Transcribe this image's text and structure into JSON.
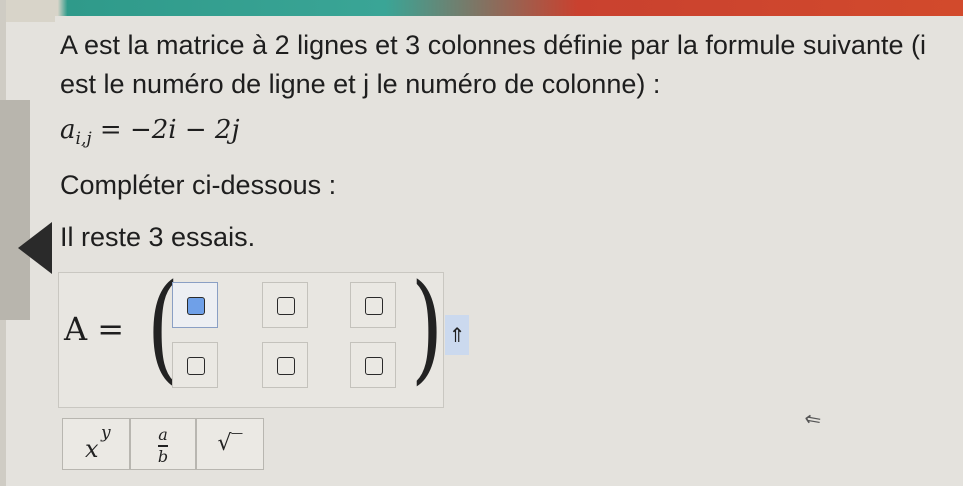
{
  "intro_lines": [
    "A est la matrice à 2 lignes et 3 colonnes définie par la formule suivante (i",
    "est le numéro de ligne et j le numéro de colonne) :"
  ],
  "formula": {
    "lhs": "a",
    "sub": "i,j",
    "rhs": "= −2i − 2j"
  },
  "instruction": "Compléter ci-dessous :",
  "attempts": "Il reste 3 essais.",
  "matrix": {
    "label": "A =",
    "submit_symbol": "⇑"
  },
  "toolbar": {
    "power_base": "x",
    "power_exp": "y",
    "frac_num": "a",
    "frac_den": "b",
    "sqrt": "√‾"
  },
  "cursor_symbol": "⇖"
}
